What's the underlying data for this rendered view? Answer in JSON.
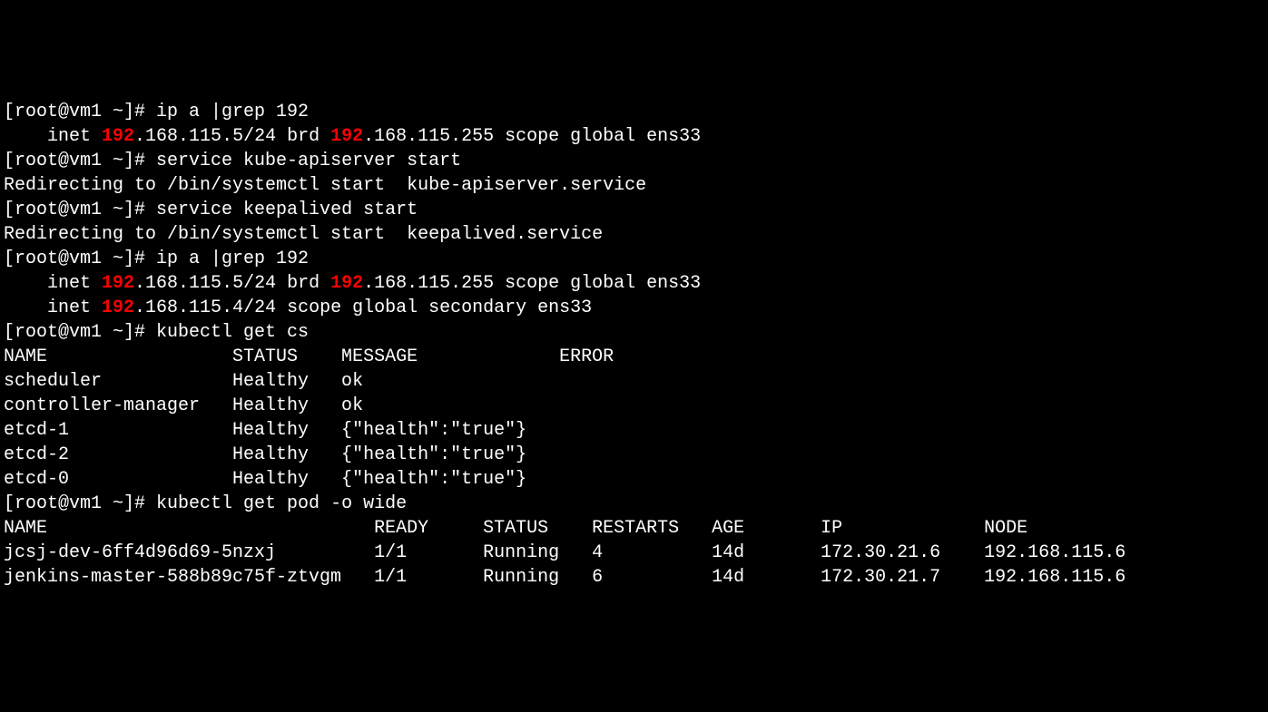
{
  "prompt": "[root@vm1 ~]# ",
  "commands": {
    "cmd1": "ip a |grep 192",
    "cmd2": "service kube-apiserver start",
    "cmd3": "service keepalived start",
    "cmd4": "ip a |grep 192",
    "cmd5": "kubectl get cs",
    "cmd6": "kubectl get pod -o wide"
  },
  "output": {
    "inet1_prefix": "    inet ",
    "ip_highlight": "192",
    "inet1_mid": ".168.115.5/24 brd ",
    "inet1_suffix": ".168.115.255 scope global ens33",
    "redirect1": "Redirecting to /bin/systemctl start  kube-apiserver.service",
    "redirect2": "Redirecting to /bin/systemctl start  keepalived.service",
    "inet2_prefix": "    inet ",
    "inet2_mid": ".168.115.5/24 brd ",
    "inet2_suffix": ".168.115.255 scope global ens33",
    "inet3_prefix": "    inet ",
    "inet3_suffix": ".168.115.4/24 scope global secondary ens33"
  },
  "cs_table": {
    "header": "NAME                 STATUS    MESSAGE             ERROR",
    "rows": [
      "scheduler            Healthy   ok",
      "controller-manager   Healthy   ok",
      "etcd-1               Healthy   {\"health\":\"true\"}",
      "etcd-2               Healthy   {\"health\":\"true\"}",
      "etcd-0               Healthy   {\"health\":\"true\"}"
    ]
  },
  "pod_table": {
    "header": "NAME                              READY     STATUS    RESTARTS   AGE       IP             NODE",
    "rows": [
      "jcsj-dev-6ff4d96d69-5nzxj         1/1       Running   4          14d       172.30.21.6    192.168.115.6",
      "jenkins-master-588b89c75f-ztvgm   1/1       Running   6          14d       172.30.21.7    192.168.115.6"
    ]
  }
}
